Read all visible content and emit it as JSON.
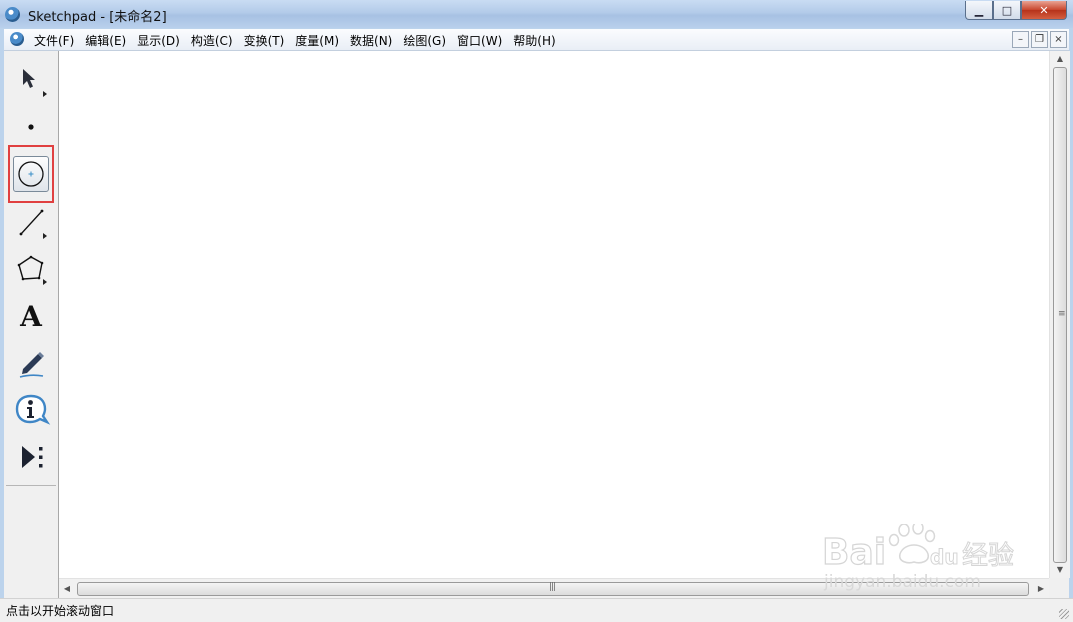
{
  "window": {
    "title": "Sketchpad  - [未命名2]",
    "buttons": {
      "minimize": "▁",
      "maximize": "□",
      "close": "✕"
    }
  },
  "menu": {
    "items": [
      "文件(F)",
      "编辑(E)",
      "显示(D)",
      "构造(C)",
      "变换(T)",
      "度量(M)",
      "数据(N)",
      "绘图(G)",
      "窗口(W)",
      "帮助(H)"
    ],
    "mdi_buttons": {
      "minimize": "–",
      "restore": "❐",
      "close": "×"
    }
  },
  "toolbox": {
    "tools": [
      {
        "name": "arrow-tool-icon",
        "selected": false
      },
      {
        "name": "point-tool-icon",
        "selected": false
      },
      {
        "name": "compass-tool-icon",
        "selected": true
      },
      {
        "name": "straightedge-tool-icon",
        "selected": false
      },
      {
        "name": "polygon-tool-icon",
        "selected": false
      },
      {
        "name": "text-tool-icon",
        "selected": false,
        "glyph": "A"
      },
      {
        "name": "marker-tool-icon",
        "selected": false
      },
      {
        "name": "information-tool-icon",
        "selected": false,
        "glyph": "i"
      },
      {
        "name": "custom-tool-icon",
        "selected": false
      }
    ],
    "highlight_color": "#e04040"
  },
  "scrollbars": {
    "vertical_grip": "≡",
    "horizontal_grip": "|||"
  },
  "status": {
    "text": "点击以开始滚动窗口"
  },
  "watermark": {
    "brand": "Bai",
    "brand2": "du",
    "suffix": "经验",
    "url": "jingyan.baidu.com"
  }
}
